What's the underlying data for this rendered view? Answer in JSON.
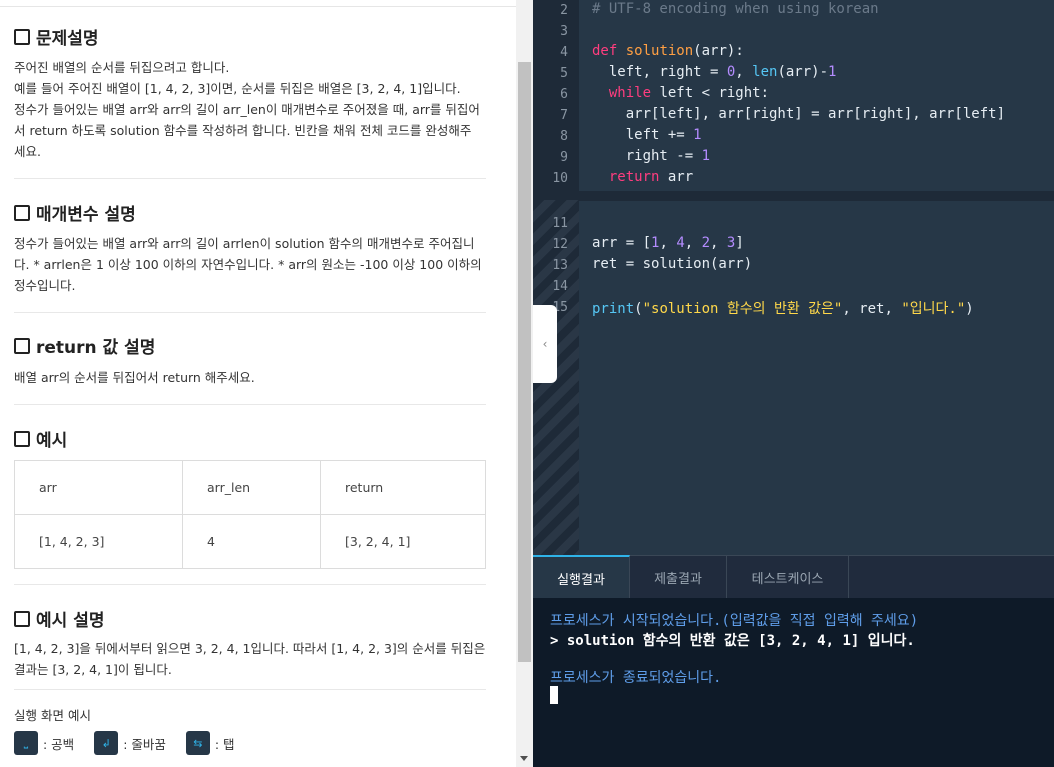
{
  "problem": {
    "desc_title": "문제설명",
    "desc_lines": [
      "주어진 배열의 순서를 뒤집으려고 합니다.",
      "예를 들어 주어진 배열이 [1, 4, 2, 3]이면, 순서를 뒤집은 배열은 [3, 2, 4, 1]입니다.",
      "정수가 들어있는 배열 arr와 arr의 길이 arr_len이 매개변수로 주어졌을 때, arr를 뒤집어",
      "서 return 하도록 solution 함수를 작성하려 합니다. 빈칸을 채워 전체 코드를 완성해주",
      "세요."
    ],
    "param_title": "매개변수 설명",
    "param_lines": [
      "정수가 들어있는 배열 arr와 arr의 길이 arrlen이 solution 함수의 매개변수로 주어집니",
      "다. * arrlen은 1 이상 100 이하의 자연수입니다. * arr의 원소는 -100 이상 100 이하의",
      "정수입니다."
    ],
    "return_title": "return 값 설명",
    "return_text": "배열 arr의 순서를 뒤집어서 return 해주세요.",
    "example_title": "예시",
    "example_table": {
      "headers": [
        "arr",
        "arr_len",
        "return"
      ],
      "row": [
        "[1, 4, 2, 3]",
        "4",
        "[3, 2, 4, 1]"
      ]
    },
    "example_desc_title": "예시 설명",
    "example_desc_lines": [
      "[1, 4, 2, 3]을 뒤에서부터 읽으면 3, 2, 4, 1입니다. 따라서 [1, 4, 2, 3]의 순서를 뒤집은",
      "결과는 [3, 2, 4, 1]이 됩니다."
    ],
    "run_example_label": "실행 화면 예시",
    "legend": [
      {
        "symbol": "⎵",
        "label": ": 공백",
        "icon": "space-icon"
      },
      {
        "symbol": "↲",
        "label": ": 줄바꿈",
        "icon": "newline-icon"
      },
      {
        "symbol": "⇆",
        "label": ": 탭",
        "icon": "tab-icon"
      }
    ]
  },
  "editor": {
    "line_numbers": [
      "2",
      "3",
      "4",
      "5",
      "6",
      "7",
      "8",
      "9",
      "10",
      "11",
      "12",
      "13",
      "14",
      "15"
    ]
  },
  "result_tabs": [
    "실행결과",
    "제출결과",
    "테스트케이스"
  ],
  "console": {
    "start": "프로세스가 시작되었습니다.(입력값을 직접 입력해 주세요)",
    "output": "> solution 함수의 반환 값은 [3, 2, 4, 1] 입니다.",
    "end": "프로세스가 종료되었습니다."
  },
  "colors": {
    "editor_bg": "#263747",
    "console_bg": "#0e1a28",
    "accent": "#2fb3e8",
    "keyword": "#ff3d7f",
    "string": "#ffd84a",
    "number": "#b48cff"
  }
}
